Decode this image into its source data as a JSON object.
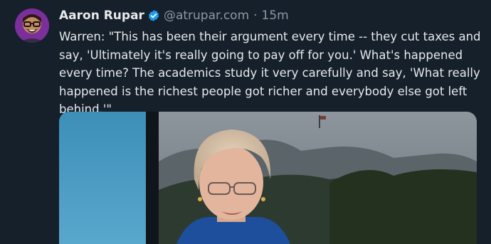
{
  "post": {
    "author_name": "Aaron Rupar",
    "handle": "@atrupar.com",
    "separator": "·",
    "time": "15m",
    "text": "Warren: \"This has been their argument every time -- they cut taxes and say, 'Ultimately it's really going to pay off for you.' What's happened every time? The academics study it very carefully and say, 'What really happened is the richest people got richer and everybody else got left behind.'\""
  },
  "icons": {
    "verified": "verified-badge-icon"
  },
  "colors": {
    "background": "#15202b",
    "text": "#e7e9ea",
    "muted": "#8b98a5",
    "verified": "#1d9bf0"
  }
}
